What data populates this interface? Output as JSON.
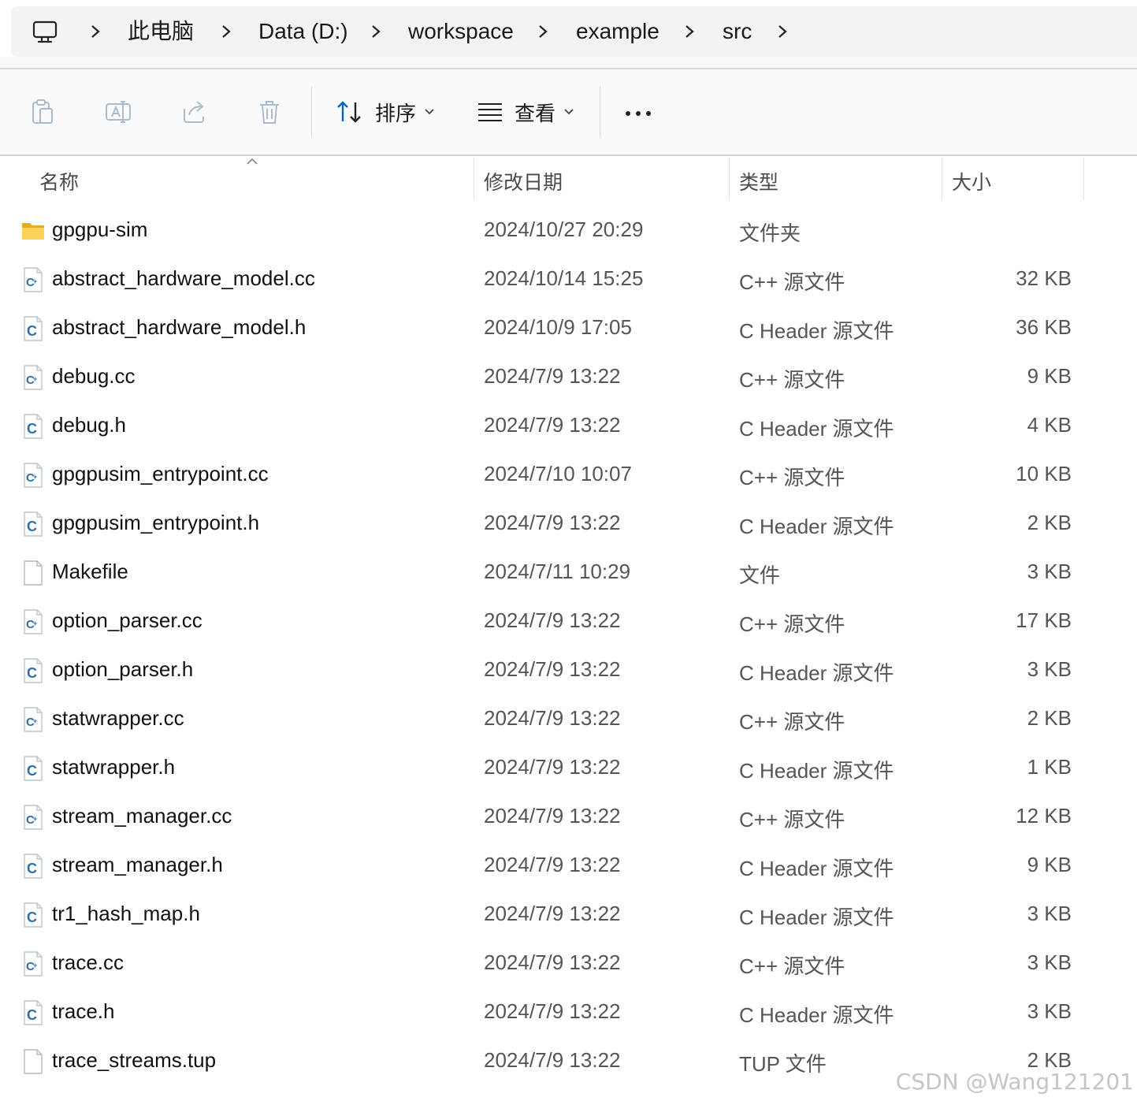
{
  "breadcrumb": {
    "items": [
      "此电脑",
      "Data (D:)",
      "workspace",
      "example",
      "src"
    ]
  },
  "toolbar": {
    "sort_label": "排序",
    "view_label": "查看"
  },
  "columns": {
    "name": "名称",
    "modified": "修改日期",
    "type": "类型",
    "size": "大小"
  },
  "files": [
    {
      "icon": "folder-icon",
      "name": "gpgpu-sim",
      "modified": "2024/10/27 20:29",
      "type": "文件夹",
      "size": ""
    },
    {
      "icon": "cpp-source-icon",
      "name": "abstract_hardware_model.cc",
      "modified": "2024/10/14 15:25",
      "type": "C++ 源文件",
      "size": "32 KB"
    },
    {
      "icon": "c-header-icon",
      "name": "abstract_hardware_model.h",
      "modified": "2024/10/9 17:05",
      "type": "C Header 源文件",
      "size": "36 KB"
    },
    {
      "icon": "cpp-source-icon",
      "name": "debug.cc",
      "modified": "2024/7/9 13:22",
      "type": "C++ 源文件",
      "size": "9 KB"
    },
    {
      "icon": "c-header-icon",
      "name": "debug.h",
      "modified": "2024/7/9 13:22",
      "type": "C Header 源文件",
      "size": "4 KB"
    },
    {
      "icon": "cpp-source-icon",
      "name": "gpgpusim_entrypoint.cc",
      "modified": "2024/7/10 10:07",
      "type": "C++ 源文件",
      "size": "10 KB"
    },
    {
      "icon": "c-header-icon",
      "name": "gpgpusim_entrypoint.h",
      "modified": "2024/7/9 13:22",
      "type": "C Header 源文件",
      "size": "2 KB"
    },
    {
      "icon": "blank-file-icon",
      "name": "Makefile",
      "modified": "2024/7/11 10:29",
      "type": "文件",
      "size": "3 KB"
    },
    {
      "icon": "cpp-source-icon",
      "name": "option_parser.cc",
      "modified": "2024/7/9 13:22",
      "type": "C++ 源文件",
      "size": "17 KB"
    },
    {
      "icon": "c-header-icon",
      "name": "option_parser.h",
      "modified": "2024/7/9 13:22",
      "type": "C Header 源文件",
      "size": "3 KB"
    },
    {
      "icon": "cpp-source-icon",
      "name": "statwrapper.cc",
      "modified": "2024/7/9 13:22",
      "type": "C++ 源文件",
      "size": "2 KB"
    },
    {
      "icon": "c-header-icon",
      "name": "statwrapper.h",
      "modified": "2024/7/9 13:22",
      "type": "C Header 源文件",
      "size": "1 KB"
    },
    {
      "icon": "cpp-source-icon",
      "name": "stream_manager.cc",
      "modified": "2024/7/9 13:22",
      "type": "C++ 源文件",
      "size": "12 KB"
    },
    {
      "icon": "c-header-icon",
      "name": "stream_manager.h",
      "modified": "2024/7/9 13:22",
      "type": "C Header 源文件",
      "size": "9 KB"
    },
    {
      "icon": "c-header-icon",
      "name": "tr1_hash_map.h",
      "modified": "2024/7/9 13:22",
      "type": "C Header 源文件",
      "size": "3 KB"
    },
    {
      "icon": "cpp-source-icon",
      "name": "trace.cc",
      "modified": "2024/7/9 13:22",
      "type": "C++ 源文件",
      "size": "3 KB"
    },
    {
      "icon": "c-header-icon",
      "name": "trace.h",
      "modified": "2024/7/9 13:22",
      "type": "C Header 源文件",
      "size": "3 KB"
    },
    {
      "icon": "blank-file-icon",
      "name": "trace_streams.tup",
      "modified": "2024/7/9 13:22",
      "type": "TUP 文件",
      "size": "2 KB"
    }
  ],
  "watermark": "CSDN @Wang121201",
  "colors": {
    "accent": "#0067c0",
    "folder": "#f8c840",
    "icon_disabled": "#9fb3c8"
  }
}
